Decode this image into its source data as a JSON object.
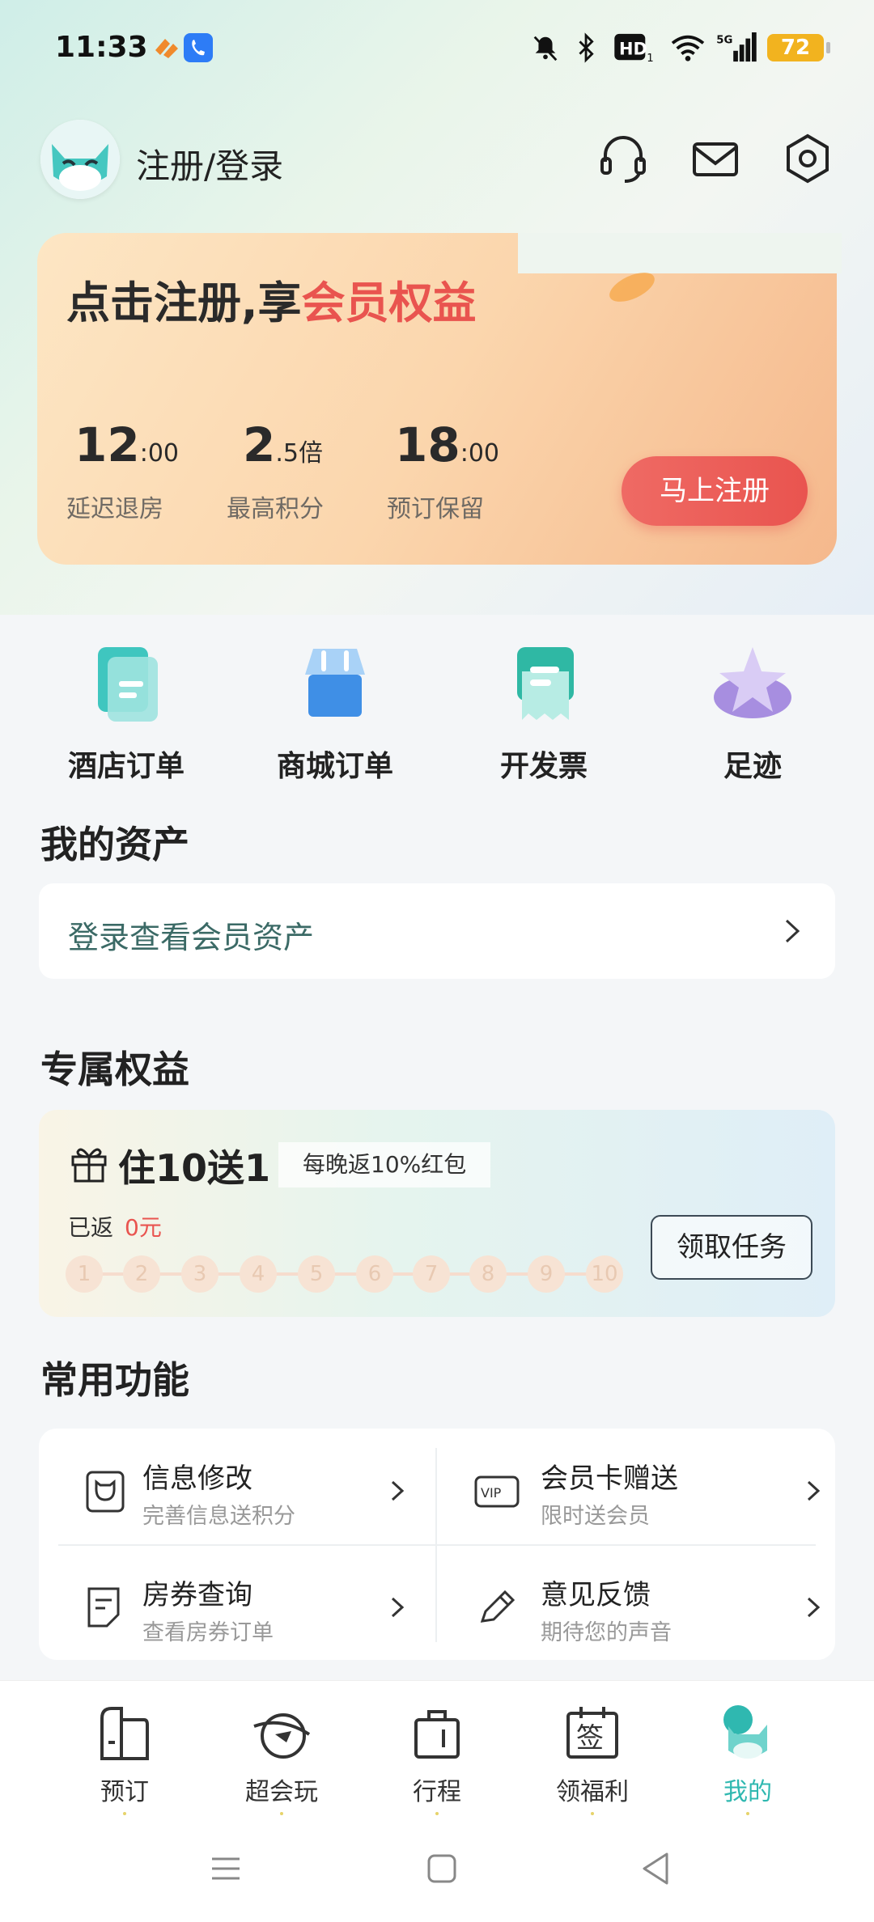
{
  "status_bar": {
    "time": "11:33",
    "battery": "72",
    "icons": [
      "mute-icon",
      "bluetooth-icon",
      "hd-icon",
      "wifi-icon",
      "signal-5g-icon"
    ]
  },
  "header": {
    "login_label": "注册/登录",
    "icons": [
      "headset-icon",
      "mail-icon",
      "settings-icon"
    ]
  },
  "register_card": {
    "title_prefix": "点击注册,享",
    "title_highlight": "会员权益",
    "stats": [
      {
        "big": "12",
        "small": ":00",
        "label": "延迟退房"
      },
      {
        "big": "2",
        "small": ".5倍",
        "label": "最高积分"
      },
      {
        "big": "18",
        "small": ":00",
        "label": "预订保留"
      }
    ],
    "button": "马上注册"
  },
  "quick_entries": [
    {
      "label": "酒店订单",
      "icon": "hotel-order-icon"
    },
    {
      "label": "商城订单",
      "icon": "mall-order-icon"
    },
    {
      "label": "开发票",
      "icon": "invoice-icon"
    },
    {
      "label": "足迹",
      "icon": "footprint-star-icon"
    }
  ],
  "assets": {
    "title": "我的资产",
    "login_prompt": "登录查看会员资产"
  },
  "benefits": {
    "title": "专属权益",
    "promo_title": "住10送1",
    "promo_tag": "每晚返10%红包",
    "returned_label": "已返",
    "returned_value": "0元",
    "steps": [
      "1",
      "2",
      "3",
      "4",
      "5",
      "6",
      "7",
      "8",
      "9",
      "10"
    ],
    "task_button": "领取任务"
  },
  "common_functions": {
    "title": "常用功能",
    "items": [
      {
        "title": "信息修改",
        "subtitle": "完善信息送积分",
        "icon": "profile-edit-icon"
      },
      {
        "title": "会员卡赠送",
        "subtitle": "限时送会员",
        "icon": "vip-card-icon"
      },
      {
        "title": "房券查询",
        "subtitle": "查看房券订单",
        "icon": "voucher-icon"
      },
      {
        "title": "意见反馈",
        "subtitle": "期待您的声音",
        "icon": "feedback-pen-icon"
      }
    ]
  },
  "bottom_nav": [
    {
      "label": "预订",
      "icon": "book-icon",
      "active": false
    },
    {
      "label": "超会玩",
      "icon": "play-planet-icon",
      "active": false
    },
    {
      "label": "行程",
      "icon": "trip-bag-icon",
      "active": false
    },
    {
      "label": "领福利",
      "icon": "signin-calendar-icon",
      "active": false
    },
    {
      "label": "我的",
      "icon": "mine-avatar-icon",
      "active": true
    }
  ],
  "nav_sign_char": "签",
  "vip_text": "VIP",
  "colors": {
    "accent": "#2fb8b0",
    "highlight": "#e9544f",
    "card": "#fbd6ad"
  }
}
